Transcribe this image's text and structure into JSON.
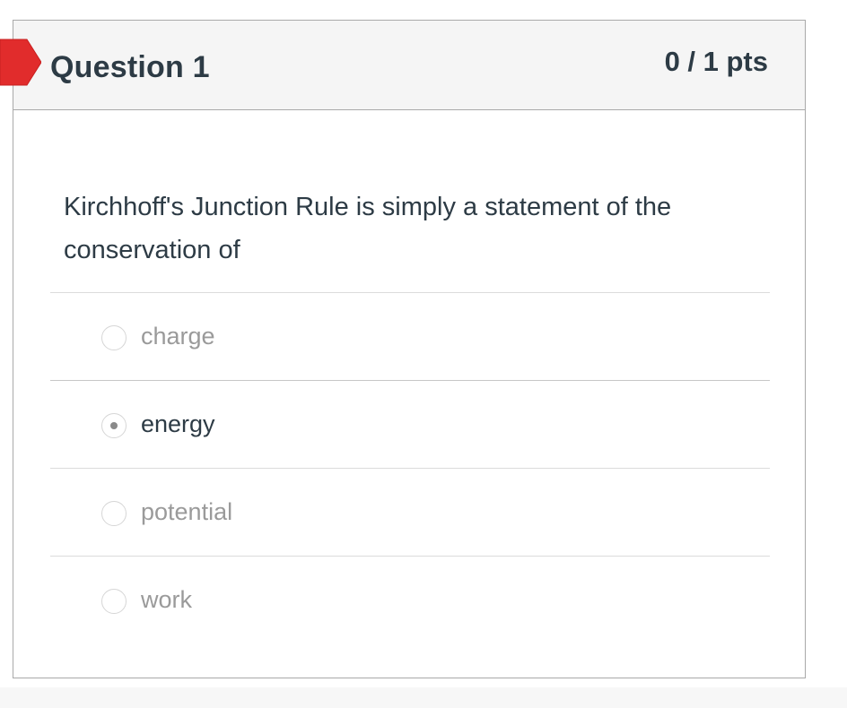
{
  "question": {
    "title": "Question 1",
    "points": "0 / 1 pts",
    "status_flag_color": "#e12c2c",
    "text": "Kirchhoff's Junction Rule is simply a statement of the conservation of"
  },
  "answers": [
    {
      "label": "charge",
      "selected": false
    },
    {
      "label": "energy",
      "selected": true
    },
    {
      "label": "potential",
      "selected": false
    },
    {
      "label": "work",
      "selected": false
    }
  ]
}
